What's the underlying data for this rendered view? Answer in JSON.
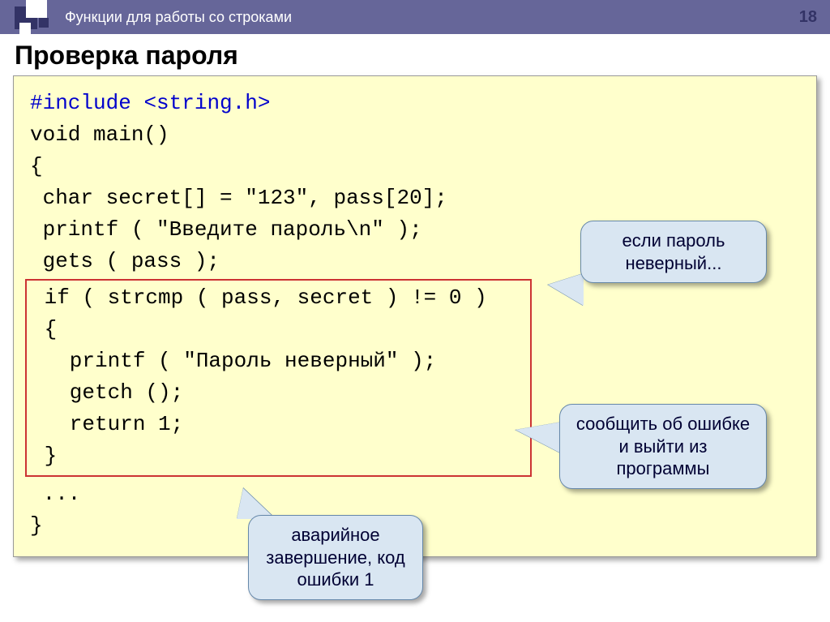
{
  "header": {
    "breadcrumb": "Функции для работы со строками",
    "page_number": "18"
  },
  "title": "Проверка пароля",
  "code": {
    "l1a": "#include ",
    "l1b": "<string.h>",
    "l2": "void main()",
    "l3": "{",
    "l4": " char secret[] = \"123\", pass[20];",
    "l5": " printf ( \"Введите пароль\\n\" );",
    "l6": " gets ( pass );",
    "h1": " if ( strcmp ( pass, secret ) != 0 )",
    "h2": " {",
    "h3": "   printf ( \"Пароль неверный\" );",
    "h4": "   getch ();",
    "h5": "   return 1;",
    "h6": " }",
    "l7": " ...",
    "l8": "}"
  },
  "callouts": {
    "c1": "если пароль неверный...",
    "c2": "сообщить об ошибке и выйти из программы",
    "c3": "аварийное завершение, код ошибки 1"
  }
}
